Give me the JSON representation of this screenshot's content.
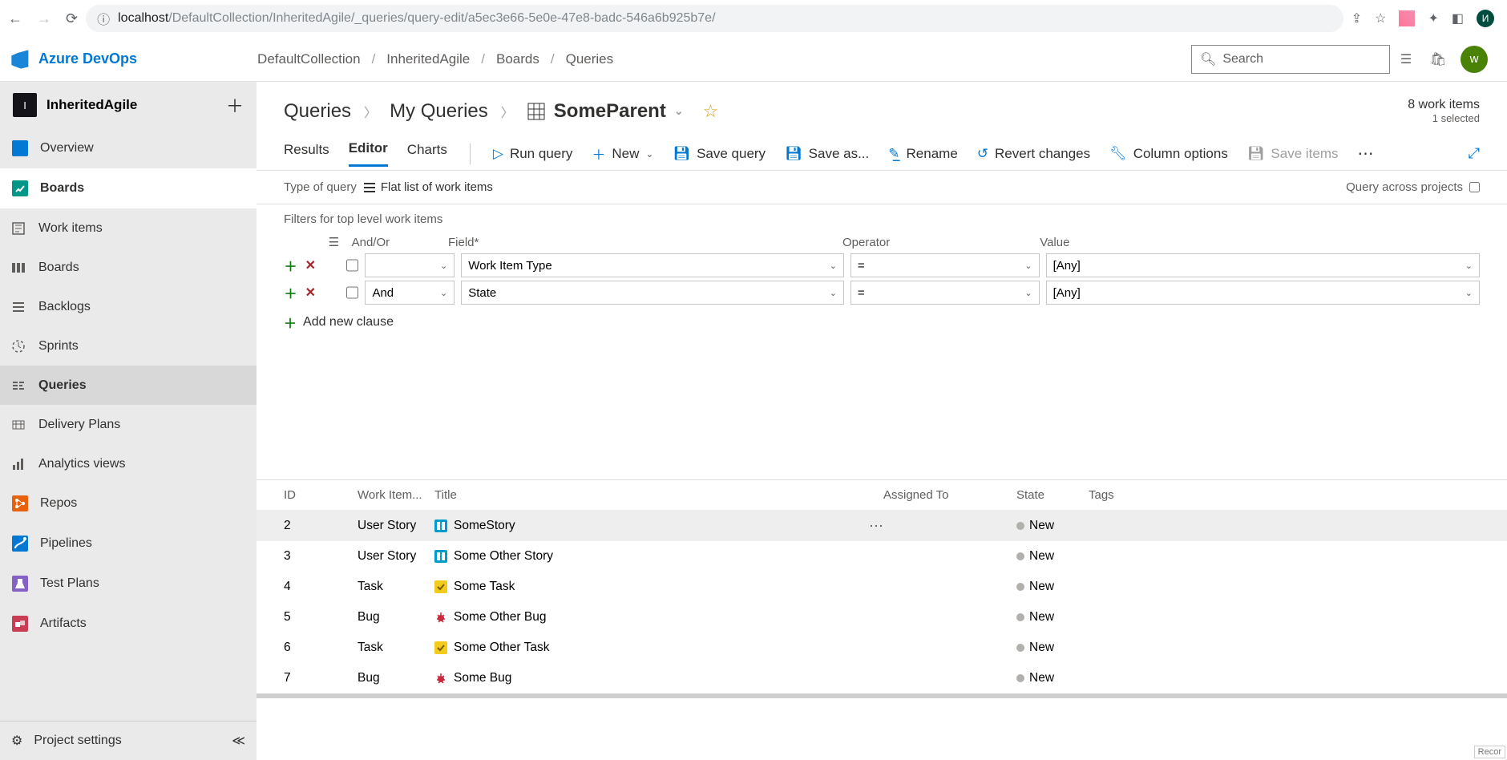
{
  "browser": {
    "url_host": "localhost",
    "url_path": "/DefaultCollection/InheritedAgile/_queries/query-edit/a5ec3e66-5e0e-47e8-badc-546a6b925b7e/",
    "avatar": "И"
  },
  "azure": {
    "brand": "Azure DevOps",
    "crumbs": [
      "DefaultCollection",
      "InheritedAgile",
      "Boards",
      "Queries"
    ],
    "search_placeholder": "Search",
    "avatar": "w"
  },
  "project": {
    "badge": "I",
    "name": "InheritedAgile"
  },
  "sidebar_top": [
    {
      "key": "overview",
      "label": "Overview"
    },
    {
      "key": "boards",
      "label": "Boards"
    }
  ],
  "boards_sub": [
    {
      "key": "workitems",
      "label": "Work items"
    },
    {
      "key": "boardsb",
      "label": "Boards"
    },
    {
      "key": "backlogs",
      "label": "Backlogs"
    },
    {
      "key": "sprints",
      "label": "Sprints"
    },
    {
      "key": "queries",
      "label": "Queries",
      "sel": true
    },
    {
      "key": "delivery",
      "label": "Delivery Plans"
    },
    {
      "key": "analytics",
      "label": "Analytics views"
    }
  ],
  "sidebar_mid": [
    {
      "key": "repos",
      "label": "Repos"
    },
    {
      "key": "pipelines",
      "label": "Pipelines"
    },
    {
      "key": "testplans",
      "label": "Test Plans"
    },
    {
      "key": "artifacts",
      "label": "Artifacts"
    }
  ],
  "sidebar_bottom": {
    "label": "Project settings"
  },
  "page": {
    "crumb1": "Queries",
    "crumb2": "My Queries",
    "title": "SomeParent",
    "count": "8 work items",
    "selected": "1 selected"
  },
  "tabs": {
    "results": "Results",
    "editor": "Editor",
    "charts": "Charts"
  },
  "toolbar": {
    "run": "Run query",
    "new": "New",
    "save": "Save query",
    "saveas": "Save as...",
    "rename": "Rename",
    "revert": "Revert changes",
    "columns": "Column options",
    "saveitems": "Save items"
  },
  "qmeta": {
    "label": "Type of query",
    "type": "Flat list of work items",
    "across": "Query across projects"
  },
  "filters": {
    "title": "Filters for top level work items",
    "headers": {
      "andor": "And/Or",
      "field": "Field*",
      "operator": "Operator",
      "value": "Value"
    },
    "rows": [
      {
        "andor": "",
        "field": "Work Item Type",
        "op": "=",
        "value": "[Any]"
      },
      {
        "andor": "And",
        "field": "State",
        "op": "=",
        "value": "[Any]"
      }
    ],
    "add": "Add new clause"
  },
  "columns": {
    "id": "ID",
    "wit": "Work Item...",
    "title": "Title",
    "assigned": "Assigned To",
    "state": "State",
    "tags": "Tags"
  },
  "rows": [
    {
      "id": "2",
      "wit": "User Story",
      "title": "SomeStory",
      "state": "New",
      "kind": "story",
      "sel": true
    },
    {
      "id": "3",
      "wit": "User Story",
      "title": "Some Other Story",
      "state": "New",
      "kind": "story"
    },
    {
      "id": "4",
      "wit": "Task",
      "title": "Some Task",
      "state": "New",
      "kind": "task"
    },
    {
      "id": "5",
      "wit": "Bug",
      "title": "Some Other Bug",
      "state": "New",
      "kind": "bug"
    },
    {
      "id": "6",
      "wit": "Task",
      "title": "Some Other Task",
      "state": "New",
      "kind": "task"
    },
    {
      "id": "7",
      "wit": "Bug",
      "title": "Some Bug",
      "state": "New",
      "kind": "bug"
    }
  ],
  "misc": {
    "recor": "Recor"
  }
}
